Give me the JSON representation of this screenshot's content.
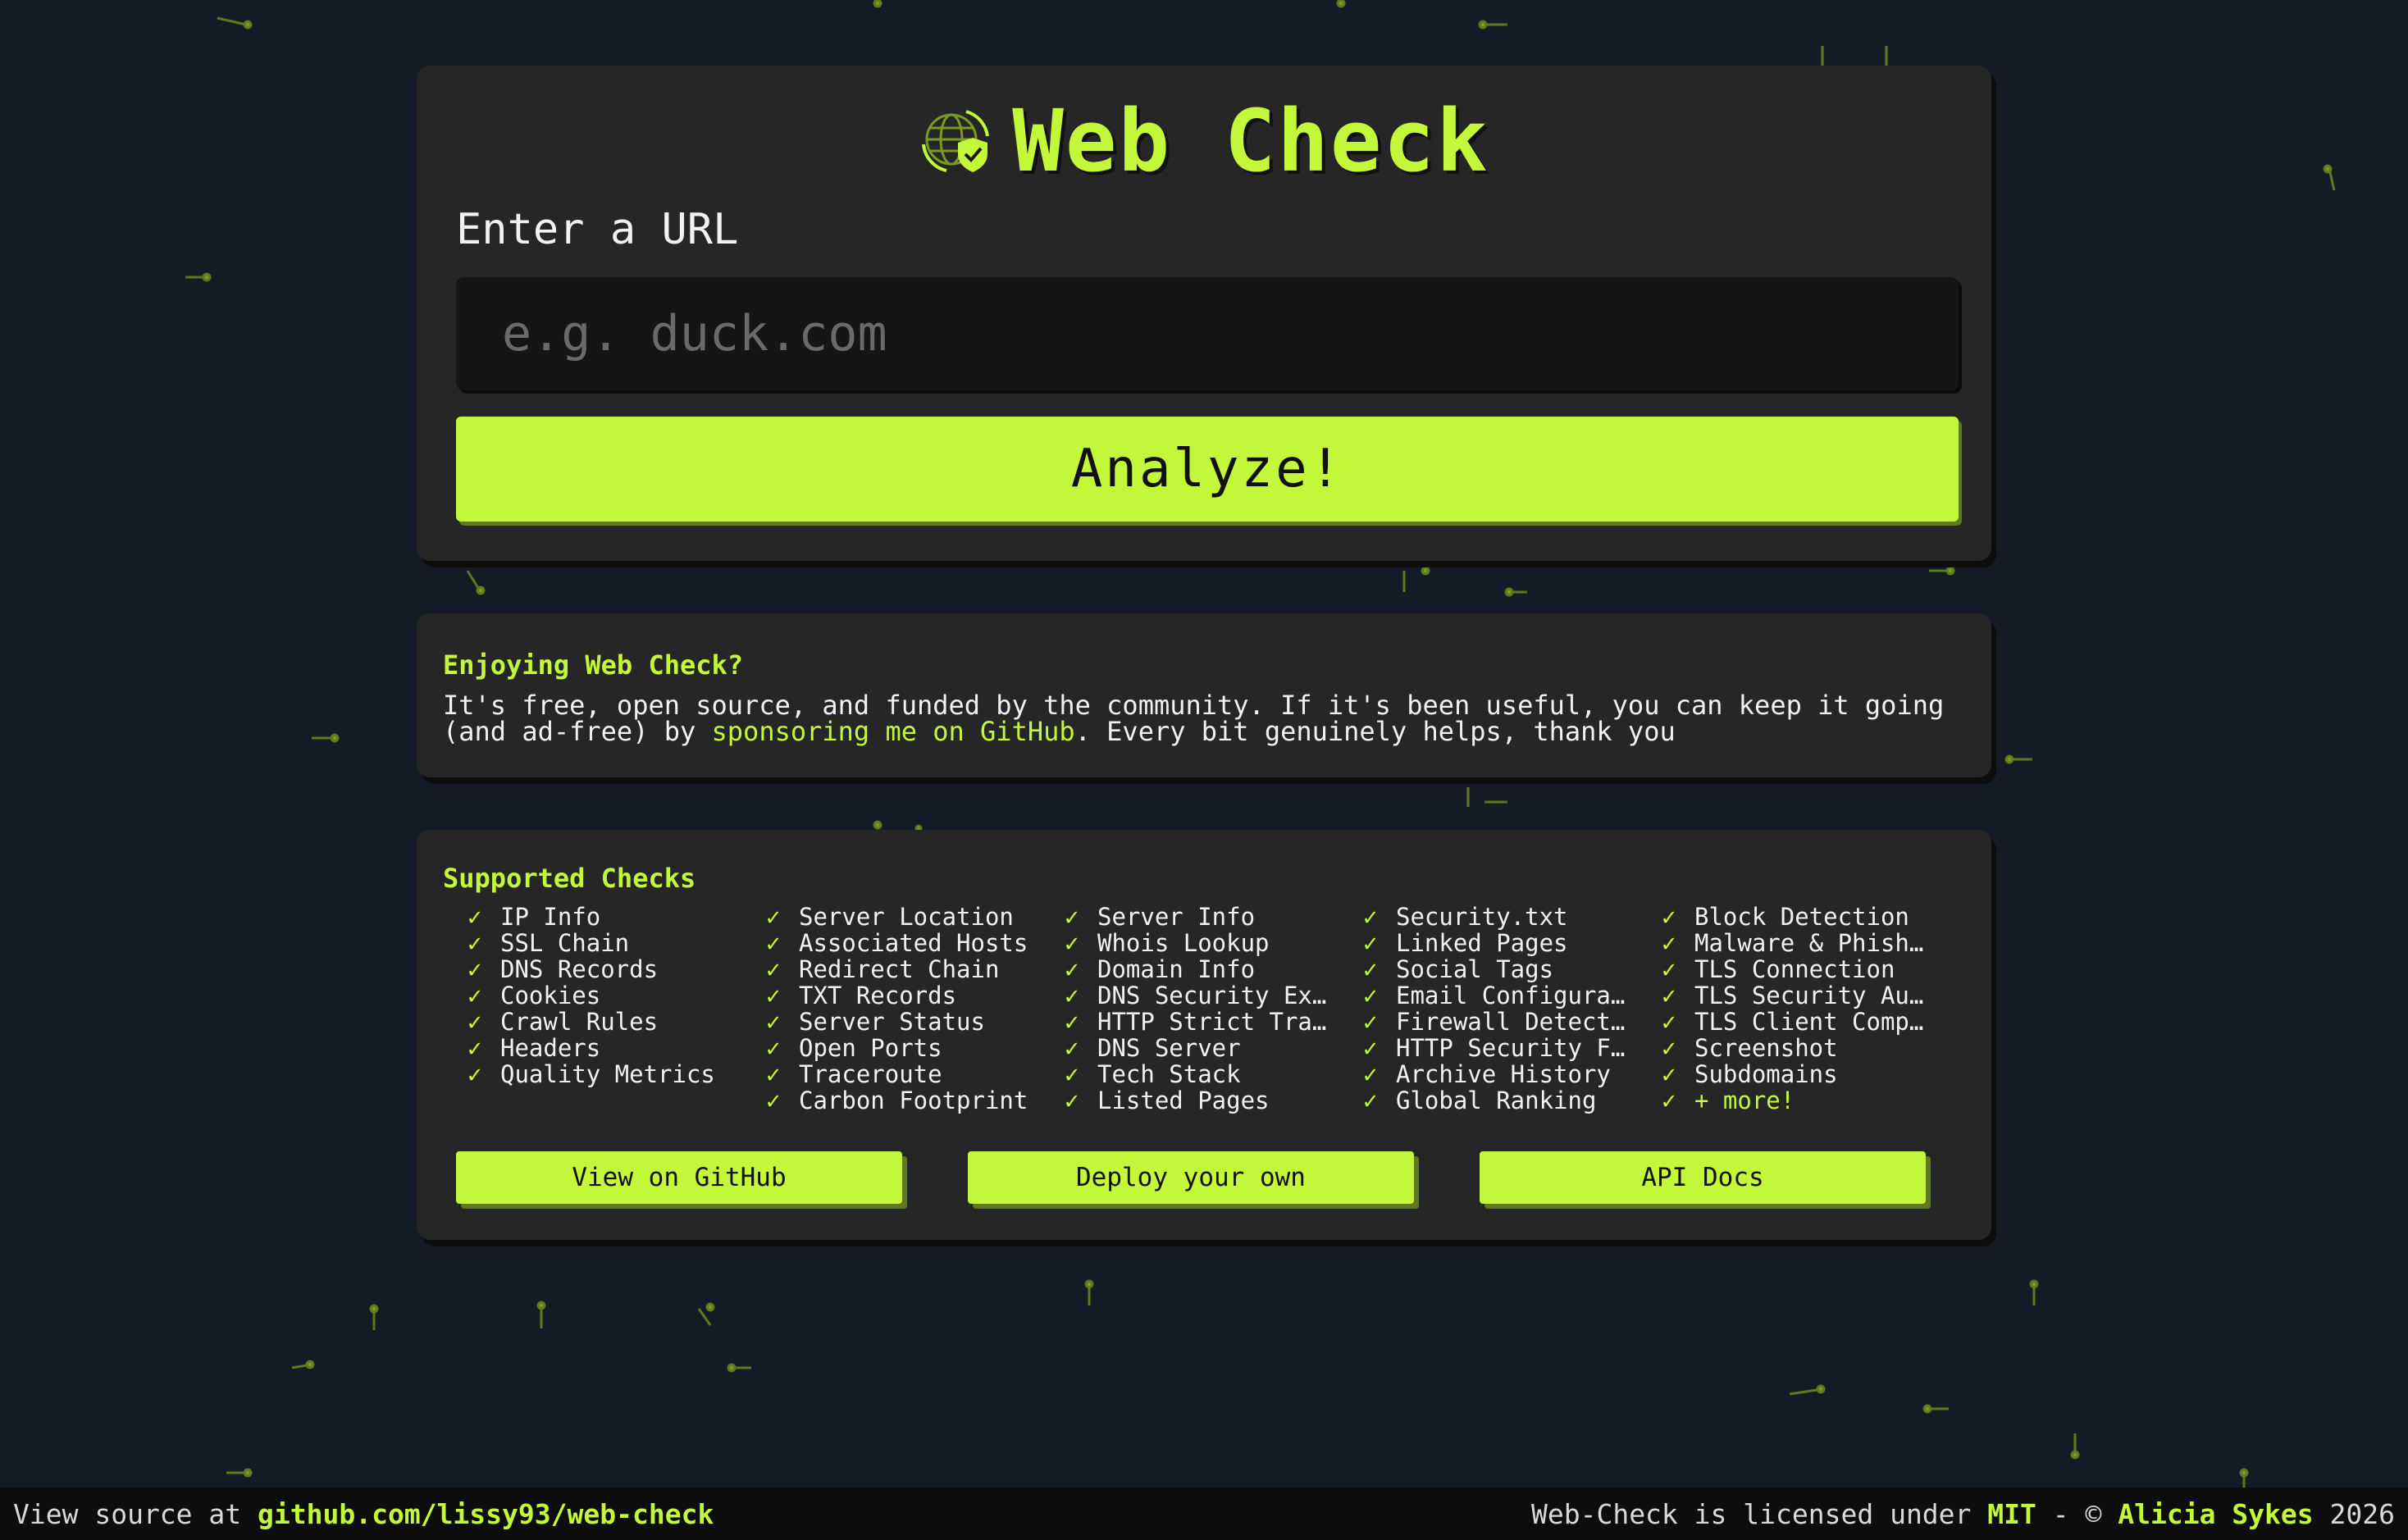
{
  "app": {
    "title": "Web Check"
  },
  "colors": {
    "accent": "#c3f73a",
    "background": "#141a26",
    "card": "#262626"
  },
  "form": {
    "label": "Enter a URL",
    "placeholder": "e.g. duck.com",
    "value": "",
    "submit_label": "Analyze!"
  },
  "sponsor": {
    "heading": "Enjoying Web Check?",
    "text_before": "It's free, open source, and funded by the community. If it's been useful, you can keep it going (and ad-free) by ",
    "link_label": "sponsoring me on GitHub",
    "text_after": ". Every bit genuinely helps, thank you"
  },
  "checks": {
    "heading": "Supported Checks",
    "tick": "✓",
    "columns": [
      [
        "IP Info",
        "SSL Chain",
        "DNS Records",
        "Cookies",
        "Crawl Rules",
        "Headers",
        "Quality Metrics"
      ],
      [
        "Server Location",
        "Associated Hosts",
        "Redirect Chain",
        "TXT Records",
        "Server Status",
        "Open Ports",
        "Traceroute",
        "Carbon Footprint"
      ],
      [
        "Server Info",
        "Whois Lookup",
        "Domain Info",
        "DNS Security Ext…",
        "HTTP Strict Tran…",
        "DNS Server",
        "Tech Stack",
        "Listed Pages"
      ],
      [
        "Security.txt",
        "Linked Pages",
        "Social Tags",
        "Email Configurat…",
        "Firewall Detecti…",
        "HTTP Security Fe…",
        "Archive History",
        "Global Ranking"
      ],
      [
        "Block Detection",
        "Malware & Phishi…",
        "TLS Connection",
        "TLS Security Aud…",
        "TLS Client Compa…",
        "Screenshot",
        "Subdomains",
        "+ more!"
      ]
    ],
    "buttons": [
      "View on GitHub",
      "Deploy your own",
      "API Docs"
    ]
  },
  "footer": {
    "left_text": "View source at ",
    "left_link": "github.com/lissy93/web-check",
    "right_text": "Web-Check is licensed under ",
    "license": "MIT",
    "separator": " - © ",
    "author": "Alicia Sykes",
    "year": " 2026"
  }
}
